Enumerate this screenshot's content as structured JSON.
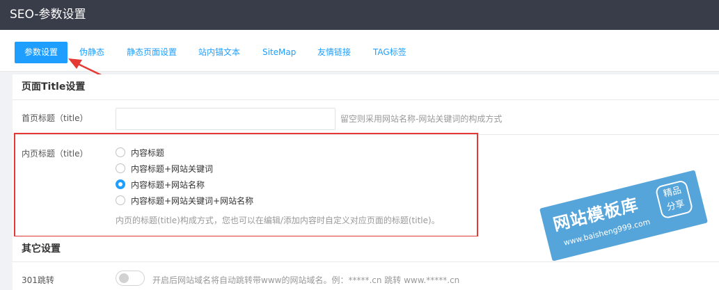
{
  "header": {
    "title": "SEO-参数设置"
  },
  "tabs": [
    {
      "label": "参数设置"
    },
    {
      "label": "伪静态"
    },
    {
      "label": "静态页面设置"
    },
    {
      "label": "站内锚文本"
    },
    {
      "label": "SiteMap"
    },
    {
      "label": "友情链接"
    },
    {
      "label": "TAG标签"
    }
  ],
  "section_title": {
    "heading": "页面Title设置"
  },
  "home_title": {
    "label": "首页标题（title）",
    "value": "",
    "hint": "留空则采用网站名称-网站关键词的构成方式"
  },
  "inner_title": {
    "label": "内页标题（title）",
    "options": [
      {
        "label": "内容标题",
        "checked": false
      },
      {
        "label": "内容标题+网站关键词",
        "checked": false
      },
      {
        "label": "内容标题+网站名称",
        "checked": true
      },
      {
        "label": "内容标题+网站关键词+网站名称",
        "checked": false
      }
    ],
    "hint": "内页的标题(title)构成方式，您也可以在编辑/添加内容时自定义对应页面的标题(title)。"
  },
  "other_settings": {
    "heading": "其它设置",
    "redirect_label": "301跳转",
    "redirect_enabled": false,
    "redirect_hint": "开启后网站域名将自动跳转带www的网站域名。例：*****.cn 跳转 www.*****.cn"
  },
  "watermark": {
    "main": "网站模板库",
    "url": "www.baisheng999.com",
    "badge_line1": "精品",
    "badge_line2": "分享"
  },
  "colors": {
    "accent": "#1e9fff",
    "topbar": "#393d49",
    "highlight": "#e53935"
  }
}
